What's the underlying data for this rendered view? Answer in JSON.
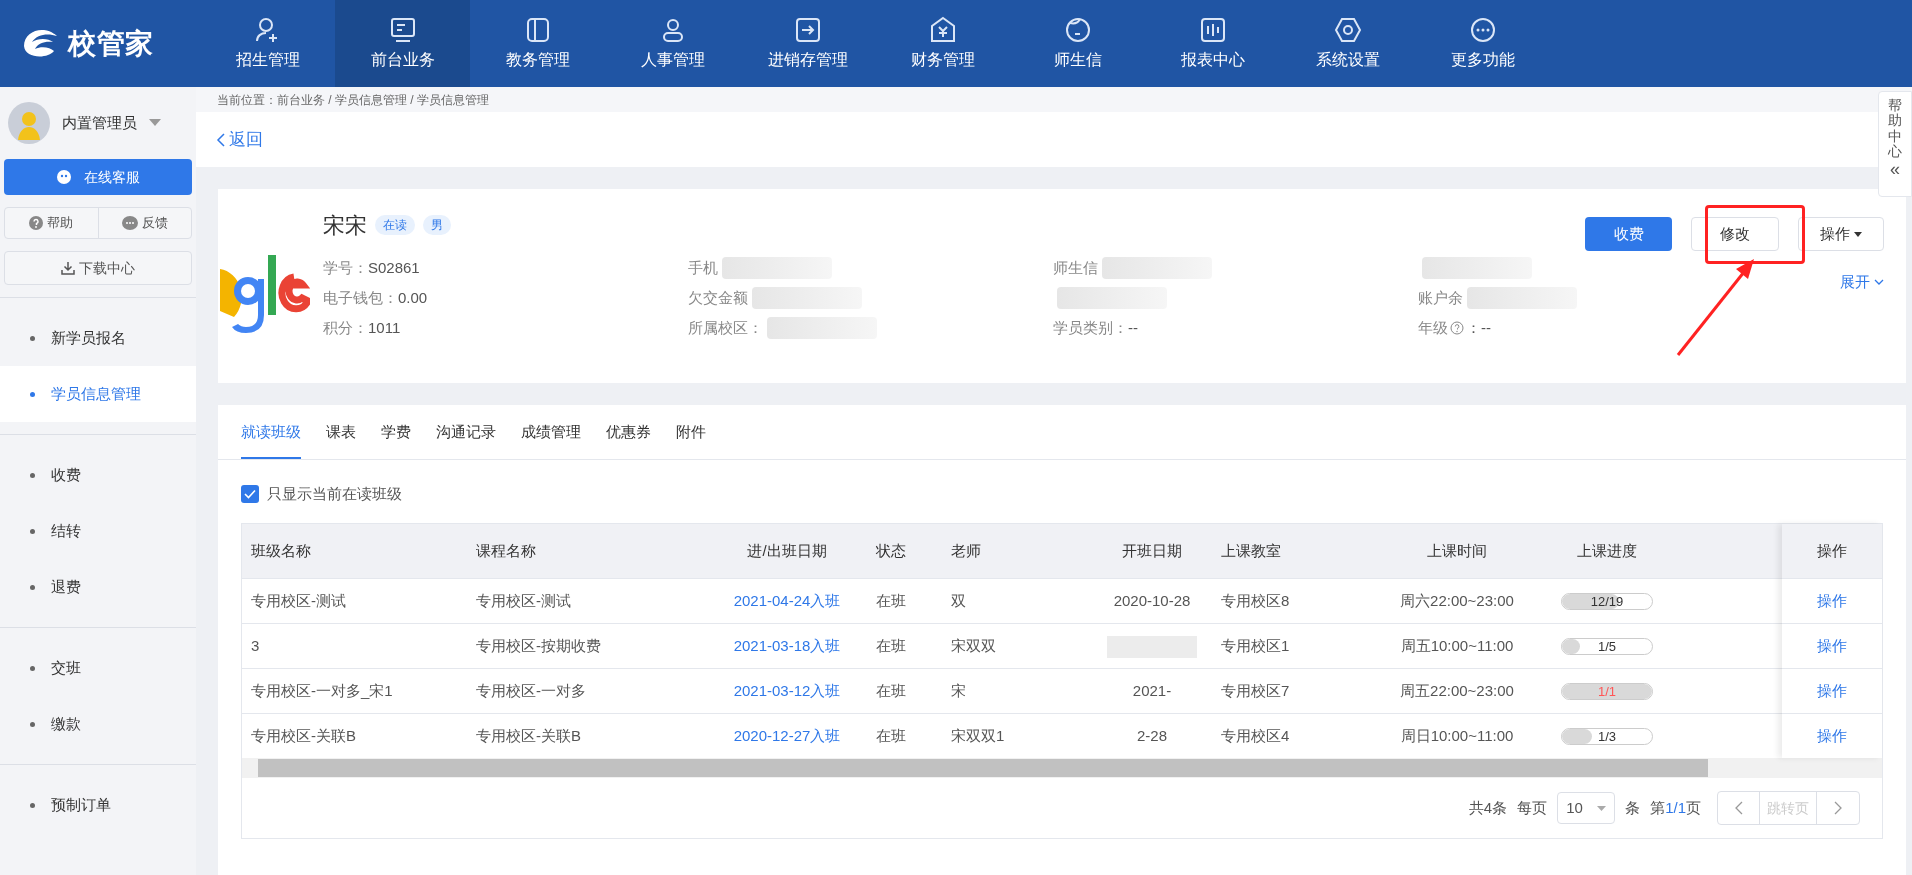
{
  "app": {
    "logo_text": "校管家"
  },
  "nav": [
    {
      "label": "招生管理",
      "selected": false
    },
    {
      "label": "前台业务",
      "selected": true
    },
    {
      "label": "教务管理",
      "selected": false
    },
    {
      "label": "人事管理",
      "selected": false
    },
    {
      "label": "进销存管理",
      "selected": false
    },
    {
      "label": "财务管理",
      "selected": false
    },
    {
      "label": "师生信",
      "selected": false
    },
    {
      "label": "报表中心",
      "selected": false
    },
    {
      "label": "系统设置",
      "selected": false
    },
    {
      "label": "更多功能",
      "selected": false
    }
  ],
  "user": {
    "name": "内置管理员"
  },
  "sidebar": {
    "service_button": "在线客服",
    "help": "帮助",
    "feedback": "反馈",
    "download": "下载中心",
    "groups": [
      [
        {
          "label": "新学员报名",
          "selected": false
        },
        {
          "label": "学员信息管理",
          "selected": true
        }
      ],
      [
        {
          "label": "收费",
          "selected": false
        },
        {
          "label": "结转",
          "selected": false
        },
        {
          "label": "退费",
          "selected": false
        }
      ],
      [
        {
          "label": "交班",
          "selected": false
        },
        {
          "label": "缴款",
          "selected": false
        }
      ],
      [
        {
          "label": "预制订单",
          "selected": false
        }
      ]
    ]
  },
  "breadcrumb": "当前位置：前台业务 / 学员信息管理 / 学员信息管理",
  "back": "返回",
  "help_center": {
    "label": "帮助中心",
    "collapse": "«"
  },
  "student": {
    "name": "宋宋",
    "tags": [
      "在读",
      "男"
    ],
    "fields": [
      [
        {
          "label": "学号：",
          "value": "S02861"
        },
        {
          "label": "电子钱包：",
          "value": "0.00"
        },
        {
          "label": "积分：",
          "value": "1011"
        }
      ],
      [
        {
          "label": "手机",
          "redacted": true
        },
        {
          "label": "欠交金额",
          "redacted": true
        },
        {
          "label": "所属校区：",
          "redacted": true
        }
      ],
      [
        {
          "label": "师生信",
          "redacted": true
        },
        {
          "redacted": true
        },
        {
          "label": "学员类别：",
          "value": "--"
        }
      ],
      [
        {
          "redacted": true
        },
        {
          "label": "账户余",
          "redacted": true
        },
        {
          "label": "年级",
          "value": "：--",
          "info": true
        }
      ]
    ],
    "buttons": [
      {
        "label": "收费",
        "kind": "primary"
      },
      {
        "label": "修改",
        "kind": "default"
      },
      {
        "label": "操作",
        "kind": "dropdown"
      }
    ],
    "expand": "展开"
  },
  "tabs": [
    {
      "label": "就读班级",
      "selected": true
    },
    {
      "label": "课表",
      "selected": false
    },
    {
      "label": "学费",
      "selected": false
    },
    {
      "label": "沟通记录",
      "selected": false
    },
    {
      "label": "成绩管理",
      "selected": false
    },
    {
      "label": "优惠券",
      "selected": false
    },
    {
      "label": "附件",
      "selected": false
    }
  ],
  "filter": {
    "label": "只显示当前在读班级",
    "checked": true
  },
  "table": {
    "columns": [
      "班级名称",
      "课程名称",
      "进/出班日期",
      "状态",
      "老师",
      "开班日期",
      "上课教室",
      "上课时间",
      "上课进度",
      "操作"
    ],
    "rows": [
      {
        "class": "专用校区-测试",
        "course": "专用校区-测试",
        "date": "2021-04-24入班",
        "status": "在班",
        "teacher": "双",
        "start": "2020-10-28",
        "room": "专用校区8",
        "time": "周六22:00~23:00",
        "progress": "12/19",
        "level": 0.63,
        "alert": false,
        "action": "操作"
      },
      {
        "class": "3",
        "course": "专用校区-按期收费",
        "date": "2021-03-18入班",
        "status": "在班",
        "teacher": "宋双双",
        "room": "专用校区1",
        "time": "周五10:00~11:00",
        "progress": "1/5",
        "level": 0.2,
        "alert": false,
        "action": "操作"
      },
      {
        "class": "专用校区-一对多_宋1",
        "course": "专用校区-一对多",
        "date": "2021-03-12入班",
        "status": "在班",
        "teacher": "宋",
        "start": "2021-",
        "room": "专用校区7",
        "time": "周五22:00~23:00",
        "progress": "1/1",
        "level": 1,
        "alert": true,
        "action": "操作"
      },
      {
        "class": "专用校区-关联B",
        "course": "专用校区-关联B",
        "date": "2020-12-27入班",
        "status": "在班",
        "teacher": "宋双双1",
        "start": "2-28",
        "room": "专用校区4",
        "time": "周日10:00~11:00",
        "progress": "1/3",
        "level": 0.33,
        "alert": false,
        "action": "操作"
      }
    ]
  },
  "pagination": {
    "total": "共4条",
    "per_page_label": "每页",
    "per_page": "10",
    "unit": "条",
    "page_prefix": "第",
    "page": "1/1",
    "page_suffix": "页",
    "jump": "跳转页"
  }
}
